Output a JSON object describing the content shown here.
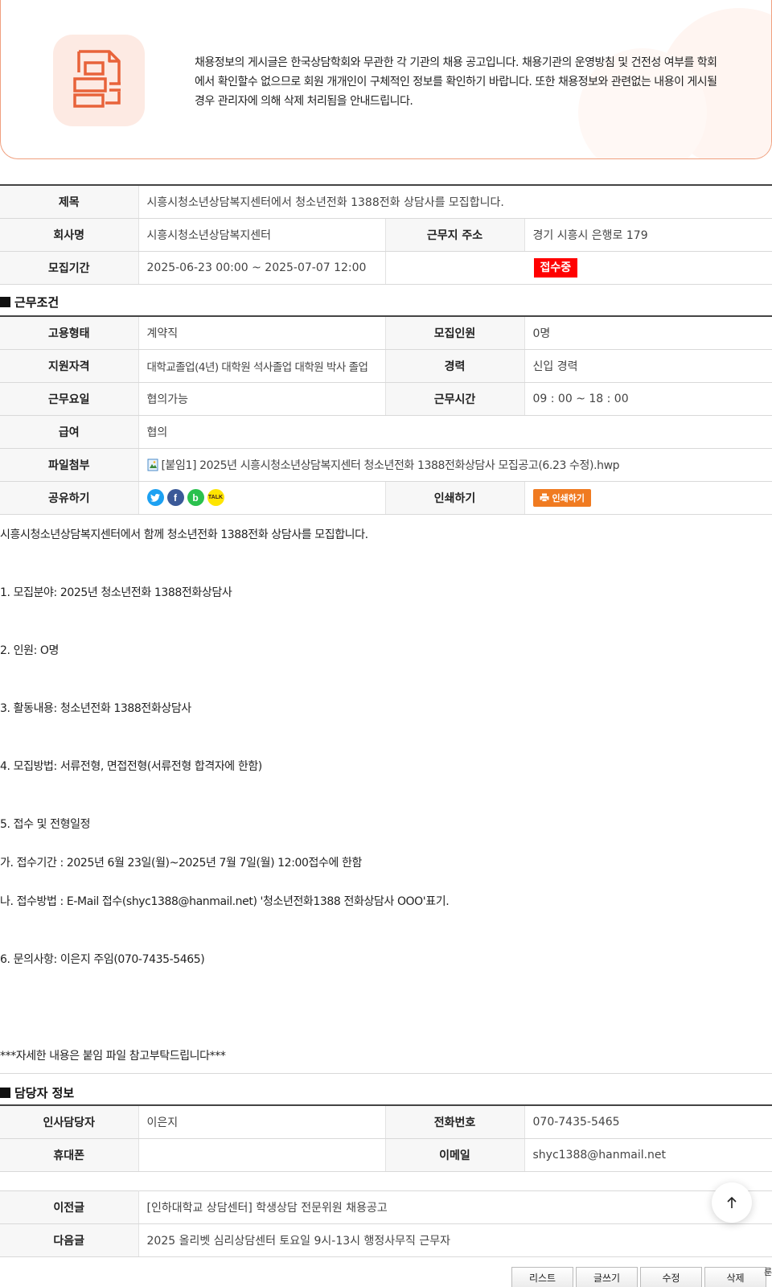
{
  "notice": {
    "lines": [
      "채용정보의 게시글은 한국상담학회와 무관한 각 기관의 채용 공고입니다. 채용기관의 운영방침 및 건전성 여부를 학회",
      "에서 확인할수 없으므로 회원 개개인이 구체적인 정보를 확인하기 바랍니다. 또한 채용정보와 관련없는 내용이 게시될",
      "경우 관리자에 의해 삭제 처리됨을 안내드립니다."
    ]
  },
  "post": {
    "title_label": "제목",
    "title": "시흥시청소년상담복지센터에서 청소년전화 1388전화 상담사를 모집합니다.",
    "company_label": "회사명",
    "company": "시흥시청소년상담복지센터",
    "address_label": "근무지 주소",
    "address": "경기 시흥시 은행로 179",
    "period_label": "모집기간",
    "period": "2025-06-23 00:00 ~ 2025-07-07 12:00",
    "status": "접수중"
  },
  "conditions": {
    "section_title": "근무조건",
    "employment_type_label": "고용형태",
    "employment_type": "계약직",
    "headcount_label": "모집인원",
    "headcount": "0명",
    "qualification_label": "지원자격",
    "qualification": "대학교졸업(4년) 대학원 석사졸업 대학원 박사 졸업",
    "career_label": "경력",
    "career": "신입 경력",
    "workdays_label": "근무요일",
    "workdays": "협의가능",
    "hours_label": "근무시간",
    "hours": "09 : 00 ~ 18 : 00",
    "salary_label": "급여",
    "salary": "협의",
    "file_label": "파일첨부",
    "file": "[붙임1] 2025년 시흥시청소년상담복지센터 청소년전화 1388전화상담사 모집공고(6.23 수정).hwp",
    "share_label": "공유하기",
    "share_icons": [
      "twitter-icon",
      "facebook-icon",
      "band-icon",
      "kakaotalk-icon"
    ],
    "print_label": "인쇄하기",
    "print_button": "인쇄하기"
  },
  "body": [
    "시흥시청소년상담복지센터에서 함께 청소년전화 1388전화 상담사를 모집합니다.",
    "1. 모집분야: 2025년 청소년전화 1388전화상담사",
    "2. 인원: O명",
    "3. 활동내용: 청소년전화 1388전화상담사",
    "4. 모집방법: 서류전형, 면접전형(서류전형 합격자에 한함)",
    "5. 접수 및 전형일정",
    " 가. 접수기간 : 2025년 6월 23일(월)~2025년 7월 7일(월) 12:00접수에 한함",
    " 나. 접수방법 : E-Mail 접수(shyc1388@hanmail.net) '청소년전화1388 전화상담사 OOO'표기.",
    "6. 문의사항: 이은지 주임(070-7435-5465)",
    "***자세한 내용은 붙임 파일 참고부탁드립니다***"
  ],
  "contact": {
    "section_title": "담당자 정보",
    "hr_label": "인사담당자",
    "hr": "이은지",
    "phone_label": "전화번호",
    "phone": "070-7435-5465",
    "mobile_label": "휴대폰",
    "mobile": "",
    "email_label": "이메일",
    "email": "shyc1388@hanmail.net"
  },
  "nav": {
    "prev_label": "이전글",
    "prev": "[인하대학교 상담센터] 학생상담 전문위원 채용공고",
    "next_label": "다음글",
    "next": "2025 올리벳 심리상담센터 토요일 9시-13시 행정사무직 근무자"
  },
  "buttons": {
    "list": "리스트",
    "write": "글쓰기",
    "edit": "수정",
    "delete": "삭제"
  },
  "cut_text": "룬",
  "colors": {
    "accent": "#e8633a",
    "status_red": "#ff0000",
    "print_orange": "#f07b21"
  }
}
